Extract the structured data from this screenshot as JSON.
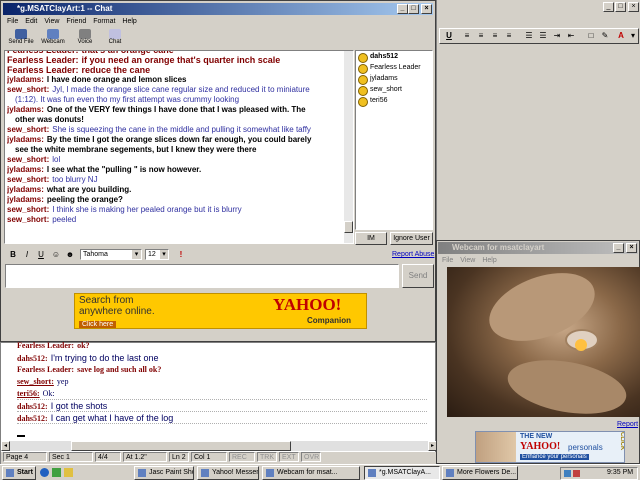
{
  "chat_window": {
    "title": "*g.MSATClayArt:1 -- Chat",
    "menu": [
      "File",
      "Edit",
      "View",
      "Friend",
      "Format",
      "Help"
    ],
    "toolbar": [
      "Send File",
      "Webcam",
      "Voice",
      "Chat"
    ],
    "messages": [
      {
        "who": "Fearless Leader:",
        "text": "that's an orange cane",
        "style": "fl"
      },
      {
        "who": "Fearless Leader:",
        "text": "if you need an orange that's quarter inch scale",
        "style": "fl"
      },
      {
        "who": "Fearless Leader:",
        "text": "reduce the cane",
        "style": "fl"
      },
      {
        "who": "jyladams:",
        "text": "I have done orange and lemon slices",
        "style": "jy"
      },
      {
        "who": "sew_short:",
        "text": "Jyl, I made the orange slice cane regular size and reduced it to miniature",
        "style": "sew"
      },
      {
        "who": "",
        "text": "(1:12). It was fun even tho my first attempt was crummy looking",
        "style": "cont"
      },
      {
        "who": "jyladams:",
        "text": "One of the VERY few things I have done that I was pleased with. The",
        "style": "jy"
      },
      {
        "who": "",
        "text": "other was donuts!",
        "style": "jycont"
      },
      {
        "who": "sew_short:",
        "text": "She is squeezing the cane in the middle and pulling it somewhat like taffy",
        "style": "sew"
      },
      {
        "who": "jyladams:",
        "text": "By the time I got the orange slices down far enough, you could barely",
        "style": "jy"
      },
      {
        "who": "",
        "text": "see the white membrane segements, but I knew they were there",
        "style": "jycont"
      },
      {
        "who": "sew_short:",
        "text": "lol",
        "style": "sew"
      },
      {
        "who": "jyladams:",
        "text": "I see what the \"pulling \" is now however.",
        "style": "jy"
      },
      {
        "who": "sew_short:",
        "text": "too blurry NJ",
        "style": "sew"
      },
      {
        "who": "jyladams:",
        "text": "what are you building.",
        "style": "jy"
      },
      {
        "who": "jyladams:",
        "text": "peeling the orange?",
        "style": "jy"
      },
      {
        "who": "sew_short:",
        "text": "I think she is making her pealed orange but it is blurry",
        "style": "sew"
      },
      {
        "who": "sew_short:",
        "text": "peeled",
        "style": "sew"
      }
    ],
    "users": [
      "dahs512",
      "Fearless Leader",
      "jyladams",
      "sew_short",
      "teri56"
    ],
    "im_button": "IM",
    "ignore_button": "Ignore User",
    "font_name": "Tahoma",
    "font_size": "12",
    "report_abuse": "Report Abuse",
    "send_button": "Send",
    "ad": {
      "line1": "Search from",
      "line2": "anywhere online.",
      "cta": "Click here",
      "brand": "YAHOO!",
      "brand_sub": "Companion"
    }
  },
  "doc_window": {
    "lines": [
      {
        "who": "Fearless Leader:",
        "text": "ok?",
        "style": "fl"
      },
      {
        "who": "dahs512:",
        "text": "I'm trying to do the last one",
        "style": "dh"
      },
      {
        "who": "Fearless Leader:",
        "text": "save log and such all ok?",
        "style": "fl2"
      },
      {
        "who": "sew_short:",
        "text": "yep",
        "style": "sw"
      },
      {
        "who": "teri56:",
        "text": "Ok:",
        "style": "sw"
      },
      {
        "who": "dahs512:",
        "text": "I got the shots",
        "style": "dh"
      },
      {
        "who": "dahs512:",
        "text": "I can get what I have of the log",
        "style": "dh"
      }
    ],
    "status": [
      "Page 4",
      "Sec 1",
      "4/4",
      "At 1.2\"",
      "Ln 2",
      "Col 1",
      "REC",
      "TRK",
      "EXT",
      "OVR"
    ]
  },
  "webcam_window": {
    "title": "Webcam for msatclayart",
    "menu": [
      "File",
      "View",
      "Help"
    ],
    "report": "Report",
    "ad": {
      "line1": "THE NEW",
      "brand": "YAHOO!",
      "line2": "personals",
      "cta": "Enhance your personals",
      "click": "CLICK"
    }
  },
  "taskbar": {
    "start": "Start",
    "items": [
      "Jasc Paint Shop Pro",
      "Yahoo! Messenger",
      "Webcam for msat...",
      "*g.MSATClayA...",
      "More Flowers De..."
    ],
    "clock": "9:35 PM"
  },
  "colors": {
    "titlebar": "#0a246a",
    "name_red": "#800000",
    "text_blue": "#3030a0",
    "yahoo_orange": "#ff8c00"
  }
}
